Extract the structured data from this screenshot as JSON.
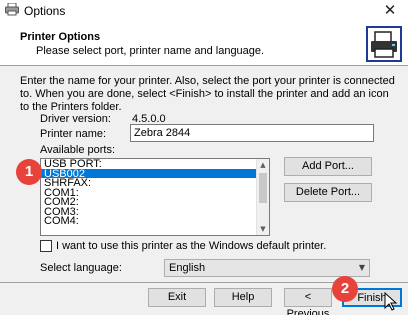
{
  "window": {
    "title": "Options",
    "close_glyph": "✕"
  },
  "header": {
    "title": "Printer Options",
    "subtitle": "Please select port, printer name and language."
  },
  "intro_text": "Enter the name for your printer. Also, select the port your printer is connected to. When you are done, select <Finish> to install the printer and add an icon to the Printers folder.",
  "driver": {
    "label": "Driver version:",
    "value": "4.5.0.0"
  },
  "printer_name": {
    "label": "Printer name:",
    "value": "Zebra 2844"
  },
  "ports": {
    "label": "Available ports:",
    "items": [
      "USB PORT:",
      "USB002",
      "SHRFAX:",
      "COM1:",
      "COM2:",
      "COM3:",
      "COM4:"
    ],
    "selected_index": 1
  },
  "buttons": {
    "add_port": "Add Port...",
    "delete_port": "Delete Port...",
    "exit": "Exit",
    "help": "Help",
    "previous": "< Previous",
    "finish": "Finish"
  },
  "default_printer": {
    "label": "I want to use this printer as the Windows default printer.",
    "checked": false
  },
  "language": {
    "label": "Select language:",
    "value": "English"
  },
  "badges": {
    "one": "1",
    "two": "2"
  },
  "icons": {
    "app": "printer-icon",
    "header_logo": "printer-install-icon",
    "cursor": "mouse-pointer-icon"
  }
}
